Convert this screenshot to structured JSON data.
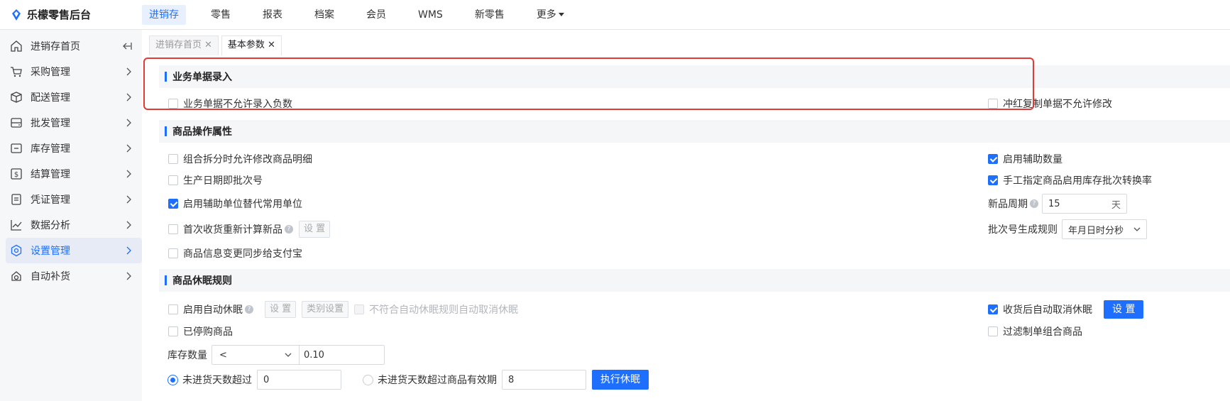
{
  "app": {
    "title": "乐檬零售后台"
  },
  "topnav": [
    {
      "label": "进销存",
      "active": true
    },
    {
      "label": "零售"
    },
    {
      "label": "报表"
    },
    {
      "label": "档案"
    },
    {
      "label": "会员"
    },
    {
      "label": "WMS"
    },
    {
      "label": "新零售"
    },
    {
      "label": "更多"
    }
  ],
  "sidebar": {
    "items": [
      {
        "label": "进销存首页",
        "icon": "home-icon"
      },
      {
        "label": "采购管理",
        "icon": "cart-icon"
      },
      {
        "label": "配送管理",
        "icon": "box-icon"
      },
      {
        "label": "批发管理",
        "icon": "server-icon"
      },
      {
        "label": "库存管理",
        "icon": "inventory-icon"
      },
      {
        "label": "结算管理",
        "icon": "dollar-icon"
      },
      {
        "label": "凭证管理",
        "icon": "voucher-icon"
      },
      {
        "label": "数据分析",
        "icon": "chart-icon"
      },
      {
        "label": "设置管理",
        "icon": "settings-icon",
        "active": true
      },
      {
        "label": "自动补货",
        "icon": "restock-icon"
      }
    ]
  },
  "tabs": [
    {
      "label": "进销存首页",
      "active": false
    },
    {
      "label": "基本参数",
      "active": true
    }
  ],
  "sections": {
    "business": {
      "title": "业务单据录入",
      "no_negative": "业务单据不允许录入负数",
      "no_modify_copy": "冲红复制单据不允许修改"
    },
    "goods_ops": {
      "title": "商品操作属性",
      "allow_modify_detail": "组合拆分时允许修改商品明细",
      "prod_date_batch": "生产日期即批次号",
      "aux_unit_replace": "启用辅助单位替代常用单位",
      "first_receive_recalc": "首次收货重新计算新品",
      "first_receive_btn": "设 置",
      "sync_alipay": "商品信息变更同步给支付宝",
      "enable_aux_qty": "启用辅助数量",
      "manual_batch_rate": "手工指定商品启用库存批次转换率",
      "new_period_label": "新品周期",
      "new_period_value": "15",
      "new_period_unit": "天",
      "batch_rule_label": "批次号生成规则",
      "batch_rule_value": "年月日时分秒"
    },
    "dormant": {
      "title": "商品休眠规则",
      "auto_dormant": "启用自动休眠",
      "setting_btn": "设 置",
      "category_btn": "类别设置",
      "auto_cancel_nonmatch": "不符合自动休眠规则自动取消休眠",
      "stopped_goods": "已停购商品",
      "cancel_after_receive": "收货后自动取消休眠",
      "cancel_setting_btn": "设 置",
      "filter_combo": "过滤制单组合商品",
      "stock_qty_label": "库存数量",
      "stock_operator": "<",
      "stock_value": "0.10",
      "no_receive_days": "未进货天数超过",
      "no_receive_days_value": "0",
      "no_receive_expiry": "未进货天数超过商品有效期",
      "no_receive_expiry_value": "8",
      "execute_btn": "执行休眠"
    }
  }
}
